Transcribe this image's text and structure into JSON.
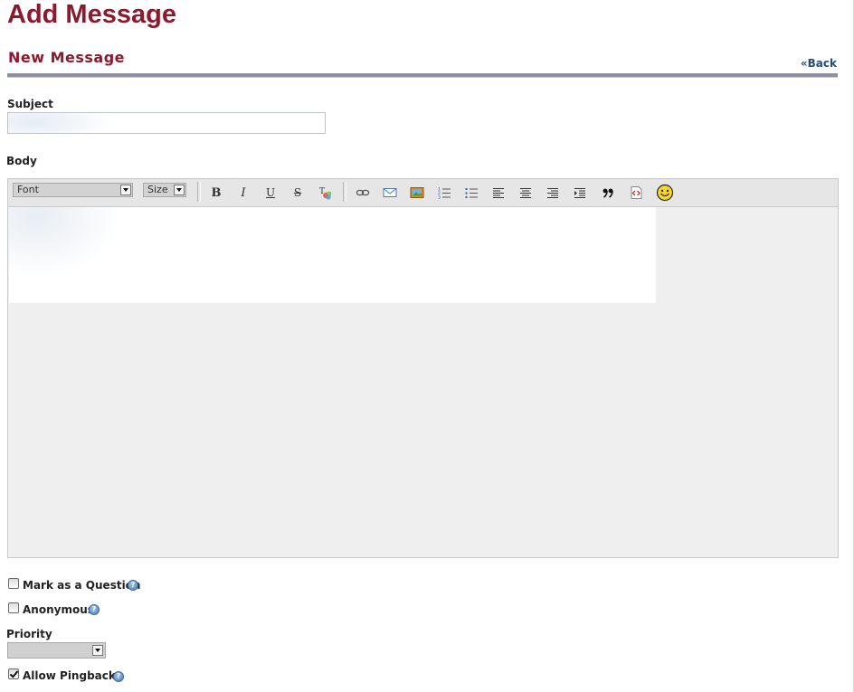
{
  "page": {
    "title": "Add Message"
  },
  "section": {
    "title": "New Message",
    "back_link": "«Back"
  },
  "form": {
    "subject": {
      "label": "Subject",
      "value": ""
    },
    "body": {
      "label": "Body"
    }
  },
  "editor": {
    "font_select": "Font",
    "size_select": "Size",
    "buttons": [
      {
        "name": "bold-icon",
        "glyph": "B"
      },
      {
        "name": "italic-icon",
        "glyph": "I"
      },
      {
        "name": "underline-icon",
        "glyph": "U"
      },
      {
        "name": "strikethrough-icon",
        "glyph": "S"
      },
      {
        "name": "text-color-icon"
      },
      {
        "name": "link-icon"
      },
      {
        "name": "email-icon"
      },
      {
        "name": "image-icon"
      },
      {
        "name": "ordered-list-icon"
      },
      {
        "name": "unordered-list-icon"
      },
      {
        "name": "align-left-icon"
      },
      {
        "name": "align-center-icon"
      },
      {
        "name": "align-right-icon"
      },
      {
        "name": "indent-icon"
      },
      {
        "name": "quote-icon"
      },
      {
        "name": "code-icon"
      },
      {
        "name": "smiley-icon"
      }
    ],
    "content": ""
  },
  "options": {
    "mark_as_question": {
      "label": "Mark as a Question",
      "checked": false
    },
    "anonymous": {
      "label": "Anonymous",
      "checked": false
    },
    "priority": {
      "label": "Priority",
      "value": ""
    },
    "allow_pingbacks": {
      "label": "Allow Pingbacks",
      "checked": true
    }
  },
  "colors": {
    "title": "#8b1a2e",
    "link": "#23507a",
    "rule": "#8a8fa6"
  }
}
